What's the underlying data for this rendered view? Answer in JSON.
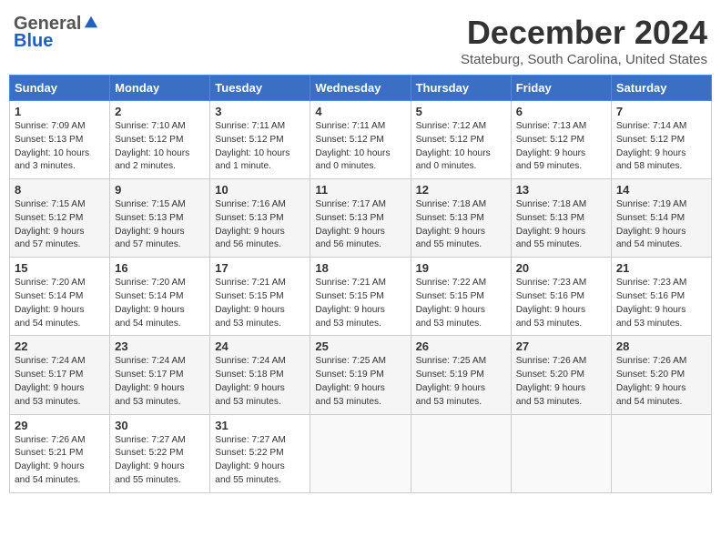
{
  "header": {
    "logo_general": "General",
    "logo_blue": "Blue",
    "month_title": "December 2024",
    "location": "Stateburg, South Carolina, United States"
  },
  "columns": [
    "Sunday",
    "Monday",
    "Tuesday",
    "Wednesday",
    "Thursday",
    "Friday",
    "Saturday"
  ],
  "weeks": [
    [
      {
        "day": "1",
        "info": "Sunrise: 7:09 AM\nSunset: 5:13 PM\nDaylight: 10 hours\nand 3 minutes."
      },
      {
        "day": "2",
        "info": "Sunrise: 7:10 AM\nSunset: 5:12 PM\nDaylight: 10 hours\nand 2 minutes."
      },
      {
        "day": "3",
        "info": "Sunrise: 7:11 AM\nSunset: 5:12 PM\nDaylight: 10 hours\nand 1 minute."
      },
      {
        "day": "4",
        "info": "Sunrise: 7:11 AM\nSunset: 5:12 PM\nDaylight: 10 hours\nand 0 minutes."
      },
      {
        "day": "5",
        "info": "Sunrise: 7:12 AM\nSunset: 5:12 PM\nDaylight: 10 hours\nand 0 minutes."
      },
      {
        "day": "6",
        "info": "Sunrise: 7:13 AM\nSunset: 5:12 PM\nDaylight: 9 hours\nand 59 minutes."
      },
      {
        "day": "7",
        "info": "Sunrise: 7:14 AM\nSunset: 5:12 PM\nDaylight: 9 hours\nand 58 minutes."
      }
    ],
    [
      {
        "day": "8",
        "info": "Sunrise: 7:15 AM\nSunset: 5:12 PM\nDaylight: 9 hours\nand 57 minutes."
      },
      {
        "day": "9",
        "info": "Sunrise: 7:15 AM\nSunset: 5:13 PM\nDaylight: 9 hours\nand 57 minutes."
      },
      {
        "day": "10",
        "info": "Sunrise: 7:16 AM\nSunset: 5:13 PM\nDaylight: 9 hours\nand 56 minutes."
      },
      {
        "day": "11",
        "info": "Sunrise: 7:17 AM\nSunset: 5:13 PM\nDaylight: 9 hours\nand 56 minutes."
      },
      {
        "day": "12",
        "info": "Sunrise: 7:18 AM\nSunset: 5:13 PM\nDaylight: 9 hours\nand 55 minutes."
      },
      {
        "day": "13",
        "info": "Sunrise: 7:18 AM\nSunset: 5:13 PM\nDaylight: 9 hours\nand 55 minutes."
      },
      {
        "day": "14",
        "info": "Sunrise: 7:19 AM\nSunset: 5:14 PM\nDaylight: 9 hours\nand 54 minutes."
      }
    ],
    [
      {
        "day": "15",
        "info": "Sunrise: 7:20 AM\nSunset: 5:14 PM\nDaylight: 9 hours\nand 54 minutes."
      },
      {
        "day": "16",
        "info": "Sunrise: 7:20 AM\nSunset: 5:14 PM\nDaylight: 9 hours\nand 54 minutes."
      },
      {
        "day": "17",
        "info": "Sunrise: 7:21 AM\nSunset: 5:15 PM\nDaylight: 9 hours\nand 53 minutes."
      },
      {
        "day": "18",
        "info": "Sunrise: 7:21 AM\nSunset: 5:15 PM\nDaylight: 9 hours\nand 53 minutes."
      },
      {
        "day": "19",
        "info": "Sunrise: 7:22 AM\nSunset: 5:15 PM\nDaylight: 9 hours\nand 53 minutes."
      },
      {
        "day": "20",
        "info": "Sunrise: 7:23 AM\nSunset: 5:16 PM\nDaylight: 9 hours\nand 53 minutes."
      },
      {
        "day": "21",
        "info": "Sunrise: 7:23 AM\nSunset: 5:16 PM\nDaylight: 9 hours\nand 53 minutes."
      }
    ],
    [
      {
        "day": "22",
        "info": "Sunrise: 7:24 AM\nSunset: 5:17 PM\nDaylight: 9 hours\nand 53 minutes."
      },
      {
        "day": "23",
        "info": "Sunrise: 7:24 AM\nSunset: 5:17 PM\nDaylight: 9 hours\nand 53 minutes."
      },
      {
        "day": "24",
        "info": "Sunrise: 7:24 AM\nSunset: 5:18 PM\nDaylight: 9 hours\nand 53 minutes."
      },
      {
        "day": "25",
        "info": "Sunrise: 7:25 AM\nSunset: 5:19 PM\nDaylight: 9 hours\nand 53 minutes."
      },
      {
        "day": "26",
        "info": "Sunrise: 7:25 AM\nSunset: 5:19 PM\nDaylight: 9 hours\nand 53 minutes."
      },
      {
        "day": "27",
        "info": "Sunrise: 7:26 AM\nSunset: 5:20 PM\nDaylight: 9 hours\nand 53 minutes."
      },
      {
        "day": "28",
        "info": "Sunrise: 7:26 AM\nSunset: 5:20 PM\nDaylight: 9 hours\nand 54 minutes."
      }
    ],
    [
      {
        "day": "29",
        "info": "Sunrise: 7:26 AM\nSunset: 5:21 PM\nDaylight: 9 hours\nand 54 minutes."
      },
      {
        "day": "30",
        "info": "Sunrise: 7:27 AM\nSunset: 5:22 PM\nDaylight: 9 hours\nand 55 minutes."
      },
      {
        "day": "31",
        "info": "Sunrise: 7:27 AM\nSunset: 5:22 PM\nDaylight: 9 hours\nand 55 minutes."
      },
      {
        "day": "",
        "info": ""
      },
      {
        "day": "",
        "info": ""
      },
      {
        "day": "",
        "info": ""
      },
      {
        "day": "",
        "info": ""
      }
    ]
  ]
}
